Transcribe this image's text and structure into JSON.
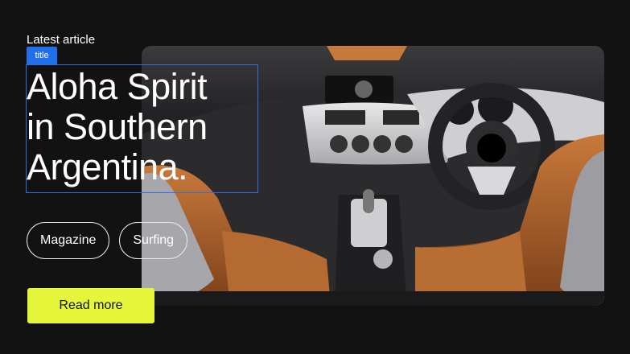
{
  "article": {
    "eyebrow": "Latest article",
    "dev_tag": "title",
    "title": "Aloha Spirit\nin Southern\nArgentina.",
    "tags": [
      "Magazine",
      "Surfing"
    ],
    "cta_label": "Read more"
  },
  "theme": {
    "background": "#121212",
    "accent": "#e4f53a",
    "dev_highlight": "#1f6feb"
  },
  "hero_image": {
    "subject": "convertible car interior with tan leather seats"
  }
}
